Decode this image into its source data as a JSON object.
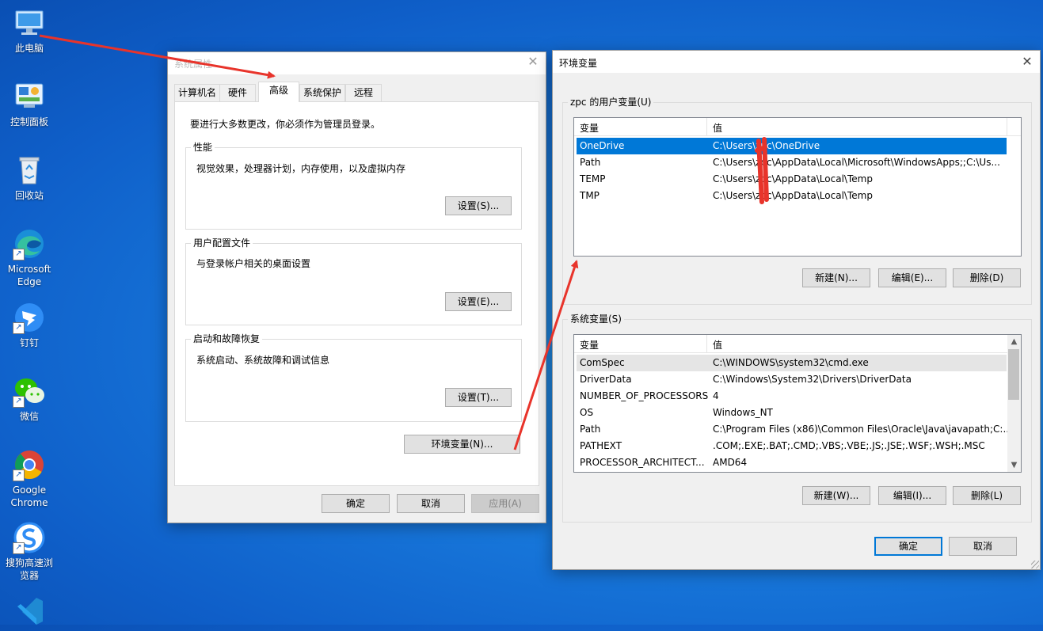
{
  "desktop": {
    "icons": [
      {
        "label": "此电脑"
      },
      {
        "label": "控制面板"
      },
      {
        "label": "回收站"
      },
      {
        "label": "Microsoft Edge"
      },
      {
        "label": "钉钉"
      },
      {
        "label": "微信"
      },
      {
        "label": "Google Chrome"
      },
      {
        "label": "搜狗高速浏览器"
      }
    ],
    "shortcut_glyph": "↗"
  },
  "sys_props": {
    "title": "系统属性",
    "tabs": [
      "计算机名",
      "硬件",
      "高级",
      "系统保护",
      "远程"
    ],
    "active_tab": "高级",
    "admin_note": "要进行大多数更改，你必须作为管理员登录。",
    "perf": {
      "label": "性能",
      "desc": "视觉效果，处理器计划，内存使用，以及虚拟内存",
      "button": "设置(S)..."
    },
    "profile": {
      "label": "用户配置文件",
      "desc": "与登录帐户相关的桌面设置",
      "button": "设置(E)..."
    },
    "startup": {
      "label": "启动和故障恢复",
      "desc": "系统启动、系统故障和调试信息",
      "button": "设置(T)..."
    },
    "env_button": "环境变量(N)...",
    "ok": "确定",
    "cancel": "取消",
    "apply": "应用(A)"
  },
  "env_vars": {
    "title": "环境变量",
    "user_group_label": "zpc 的用户变量(U)",
    "col_var": "变量",
    "col_val": "值",
    "user_rows": [
      {
        "name": "OneDrive",
        "value": "C:\\Users\\zpc\\OneDrive"
      },
      {
        "name": "Path",
        "value": "C:\\Users\\zpc\\AppData\\Local\\Microsoft\\WindowsApps;;C:\\Us..."
      },
      {
        "name": "TEMP",
        "value": "C:\\Users\\zpc\\AppData\\Local\\Temp"
      },
      {
        "name": "TMP",
        "value": "C:\\Users\\zpc\\AppData\\Local\\Temp"
      }
    ],
    "user_new": "新建(N)...",
    "user_edit": "编辑(E)...",
    "user_delete": "删除(D)",
    "sys_group_label": "系统变量(S)",
    "sys_rows": [
      {
        "name": "ComSpec",
        "value": "C:\\WINDOWS\\system32\\cmd.exe"
      },
      {
        "name": "DriverData",
        "value": "C:\\Windows\\System32\\Drivers\\DriverData"
      },
      {
        "name": "NUMBER_OF_PROCESSORS",
        "value": "4"
      },
      {
        "name": "OS",
        "value": "Windows_NT"
      },
      {
        "name": "Path",
        "value": "C:\\Program Files (x86)\\Common Files\\Oracle\\Java\\javapath;C:..."
      },
      {
        "name": "PATHEXT",
        "value": ".COM;.EXE;.BAT;.CMD;.VBS;.VBE;.JS;.JSE;.WSF;.WSH;.MSC"
      },
      {
        "name": "PROCESSOR_ARCHITECT...",
        "value": "AMD64"
      }
    ],
    "sys_new": "新建(W)...",
    "sys_edit": "编辑(I)...",
    "sys_delete": "删除(L)",
    "ok": "确定",
    "cancel": "取消"
  },
  "glyphs": {
    "close": "✕",
    "up": "▲",
    "down": "▼"
  },
  "colors": {
    "selection": "#0078d7",
    "annotation_red": "#e8342b",
    "desktop_blue": "#1a7fe0"
  }
}
